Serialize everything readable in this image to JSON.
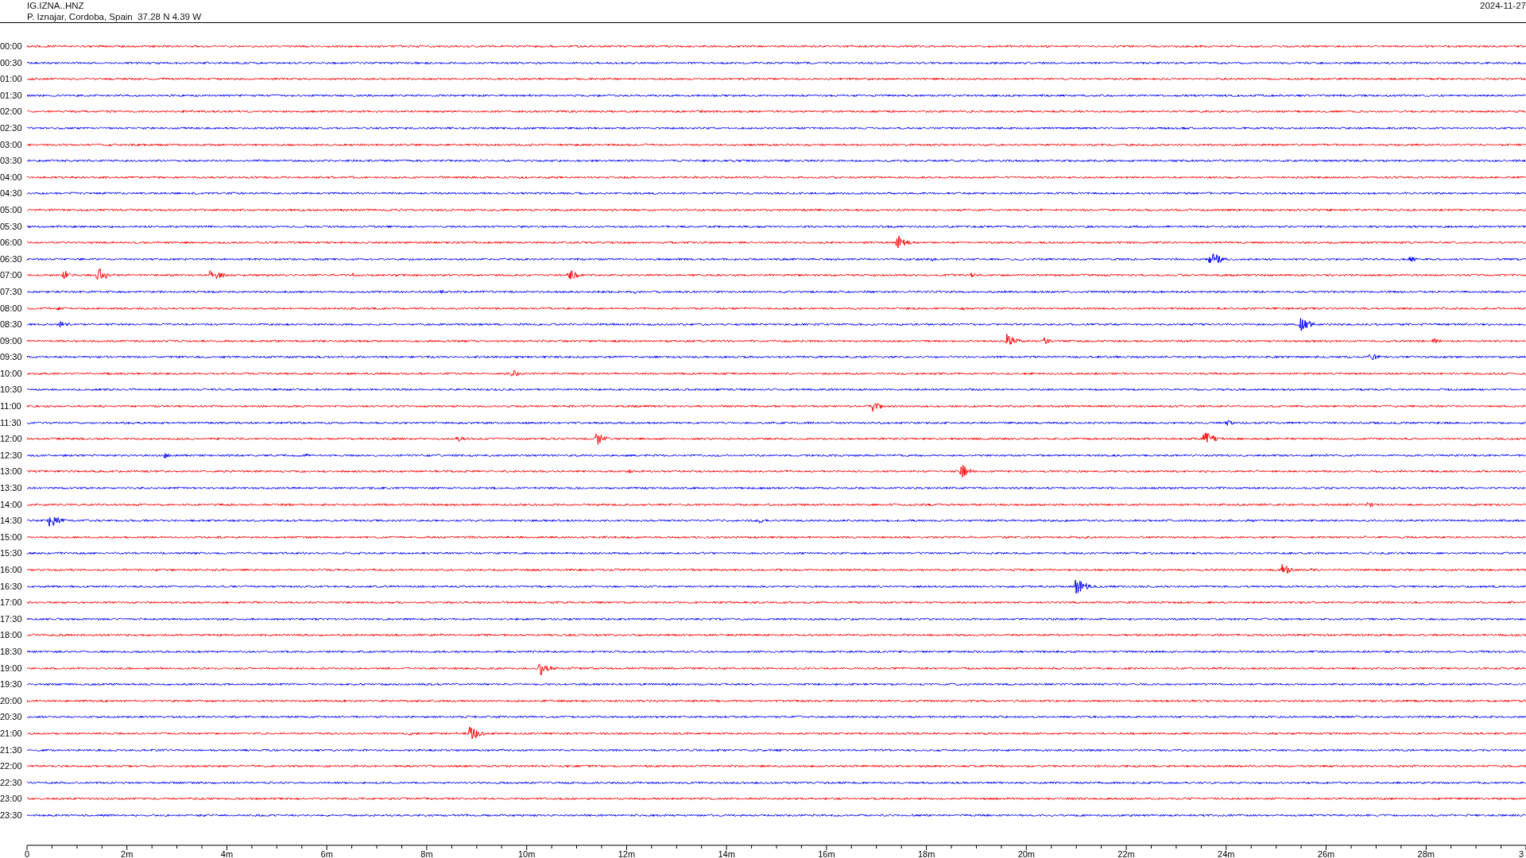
{
  "header": {
    "station": "IG.IZNA..HNZ",
    "location": "P. Iznajar, Cordoba, Spain  37.28 N 4.39 W",
    "date": "2024-11-27"
  },
  "traces": [
    {
      "time": "00:00",
      "color": "#ff0000"
    },
    {
      "time": "00:30",
      "color": "#0000ff"
    },
    {
      "time": "01:00",
      "color": "#ff0000"
    },
    {
      "time": "01:30",
      "color": "#0000ff"
    },
    {
      "time": "02:00",
      "color": "#ff0000"
    },
    {
      "time": "02:30",
      "color": "#0000ff"
    },
    {
      "time": "03:00",
      "color": "#ff0000"
    },
    {
      "time": "03:30",
      "color": "#0000ff"
    },
    {
      "time": "04:00",
      "color": "#ff0000"
    },
    {
      "time": "04:30",
      "color": "#0000ff"
    },
    {
      "time": "05:00",
      "color": "#ff0000"
    },
    {
      "time": "05:30",
      "color": "#0000ff"
    },
    {
      "time": "06:00",
      "color": "#ff0000"
    },
    {
      "time": "06:30",
      "color": "#0000ff"
    },
    {
      "time": "07:00",
      "color": "#ff0000"
    },
    {
      "time": "07:30",
      "color": "#0000ff"
    },
    {
      "time": "08:00",
      "color": "#ff0000"
    },
    {
      "time": "08:30",
      "color": "#0000ff"
    },
    {
      "time": "09:00",
      "color": "#ff0000"
    },
    {
      "time": "09:30",
      "color": "#0000ff"
    },
    {
      "time": "10:00",
      "color": "#ff0000"
    },
    {
      "time": "10:30",
      "color": "#0000ff"
    },
    {
      "time": "11:00",
      "color": "#ff0000"
    },
    {
      "time": "11:30",
      "color": "#0000ff"
    },
    {
      "time": "12:00",
      "color": "#ff0000"
    },
    {
      "time": "12:30",
      "color": "#0000ff"
    },
    {
      "time": "13:00",
      "color": "#ff0000"
    },
    {
      "time": "13:30",
      "color": "#0000ff"
    },
    {
      "time": "14:00",
      "color": "#ff0000"
    },
    {
      "time": "14:30",
      "color": "#0000ff"
    },
    {
      "time": "15:00",
      "color": "#ff0000"
    },
    {
      "time": "15:30",
      "color": "#0000ff"
    },
    {
      "time": "16:00",
      "color": "#ff0000"
    },
    {
      "time": "16:30",
      "color": "#0000ff"
    },
    {
      "time": "17:00",
      "color": "#ff0000"
    },
    {
      "time": "17:30",
      "color": "#0000ff"
    },
    {
      "time": "18:00",
      "color": "#ff0000"
    },
    {
      "time": "18:30",
      "color": "#0000ff"
    },
    {
      "time": "19:00",
      "color": "#ff0000"
    },
    {
      "time": "19:30",
      "color": "#0000ff"
    },
    {
      "time": "20:00",
      "color": "#ff0000"
    },
    {
      "time": "20:30",
      "color": "#0000ff"
    },
    {
      "time": "21:00",
      "color": "#ff0000"
    },
    {
      "time": "21:30",
      "color": "#0000ff"
    },
    {
      "time": "22:00",
      "color": "#ff0000"
    },
    {
      "time": "22:30",
      "color": "#0000ff"
    },
    {
      "time": "23:00",
      "color": "#ff0000"
    },
    {
      "time": "23:30",
      "color": "#0000ff"
    }
  ],
  "x_axis": {
    "tick_labels": [
      "0",
      "2m",
      "4m",
      "6m",
      "8m",
      "10m",
      "12m",
      "14m",
      "16m",
      "18m",
      "20m",
      "22m",
      "24m",
      "26m",
      "28m",
      "3"
    ]
  }
}
